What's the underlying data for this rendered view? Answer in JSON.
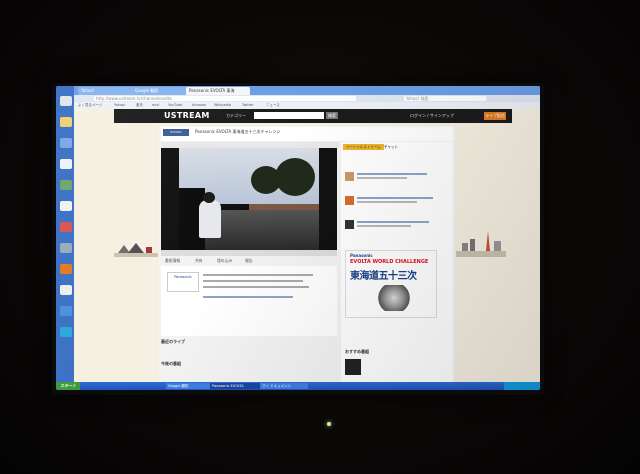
{
  "browser": {
    "tabs": [
      {
        "label": "Yahoo!"
      },
      {
        "label": "Google 翻訳"
      },
      {
        "label": "Panasonic EVOLTA 東海"
      }
    ],
    "url": "http://www.ustream.tv/channel/evolta",
    "search_placeholder": "Yahoo! 検索",
    "bookmarks": [
      "よく見るページ",
      "Yahoo!",
      "楽天",
      "mixi",
      "YouTube",
      "Amazon",
      "Wikipedia",
      "Twitter",
      "ニュース"
    ]
  },
  "ustream": {
    "logo": "USTREAM",
    "category_menu": "カテゴリー",
    "search_button": "検索",
    "login": "ログイン / サインアップ",
    "go_live": "ライブ配信",
    "channel_title": "Panasonic EVOLTA 東海道五十三次チャレンジ",
    "player_tabs": [
      "番組情報",
      "共有",
      "埋め込み",
      "報告"
    ],
    "side_tabs": [
      "ソーシャルストリーム",
      "チャット"
    ],
    "sections": [
      "最近のライブ",
      "今後の番組"
    ],
    "recommend": "おすすめ番組"
  },
  "ad": {
    "brand": "Panasonic",
    "campaign": "EVOLTA WORLD CHALLENGE",
    "title": "東海道五十三次"
  },
  "taskbar": {
    "start": "スタート",
    "tasks": [
      "Panasonic EVOLTA",
      "Google 翻訳",
      "マイ ドキュメント"
    ]
  },
  "colors": {
    "desktop": "#3a6fc4",
    "ustream_header": "#1b1b1b",
    "go_live": "#e07a1f",
    "taskbar": "#1f54b8"
  }
}
